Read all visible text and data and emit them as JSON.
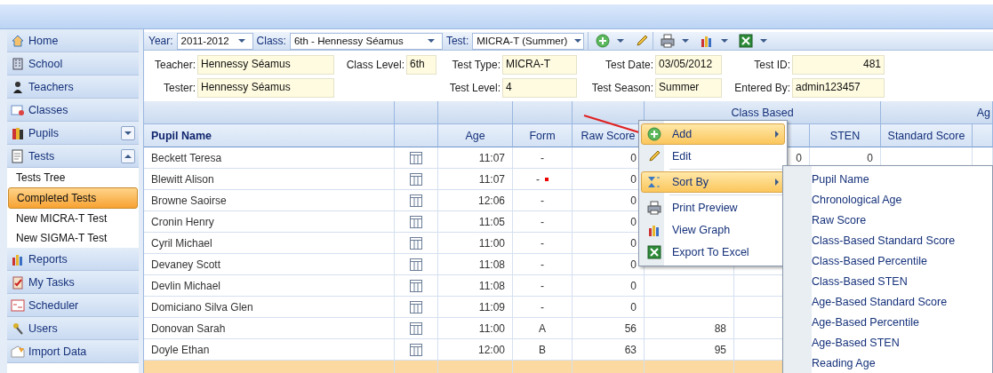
{
  "sidebar": {
    "items": [
      {
        "label": "Home"
      },
      {
        "label": "School"
      },
      {
        "label": "Teachers"
      },
      {
        "label": "Classes"
      },
      {
        "label": "Pupils",
        "expanded": false
      },
      {
        "label": "Tests",
        "expanded": true,
        "children": [
          {
            "label": "Tests Tree",
            "selected": false
          },
          {
            "label": "Completed Tests",
            "selected": true
          },
          {
            "label": "New MICRA-T Test",
            "selected": false
          },
          {
            "label": "New SIGMA-T Test",
            "selected": false
          }
        ]
      },
      {
        "label": "Reports"
      },
      {
        "label": "My Tasks"
      },
      {
        "label": "Scheduler"
      },
      {
        "label": "Users"
      },
      {
        "label": "Import Data"
      }
    ]
  },
  "toolbar": {
    "filters": [
      {
        "label": "Year:",
        "value": "2011-2012"
      },
      {
        "label": "Class:",
        "value": "6th - Hennessy Séamus"
      },
      {
        "label": "Test:",
        "value": "MICRA-T (Summer)"
      }
    ]
  },
  "details": {
    "teacher": {
      "label": "Teacher:",
      "value": "Hennessy Séamus"
    },
    "class_level": {
      "label": "Class Level:",
      "value": "6th"
    },
    "test_type": {
      "label": "Test Type:",
      "value": "MICRA-T"
    },
    "test_date": {
      "label": "Test Date:",
      "value": "03/05/2012"
    },
    "test_id": {
      "label": "Test ID:",
      "value": "481"
    },
    "tester": {
      "label": "Tester:",
      "value": "Hennessy Séamus"
    },
    "test_level": {
      "label": "Test Level:",
      "value": "4"
    },
    "test_season": {
      "label": "Test Season:",
      "value": "Summer"
    },
    "entered_by": {
      "label": "Entered By:",
      "value": "admin123457"
    }
  },
  "table": {
    "groups": [
      {
        "label": "Class Based"
      },
      {
        "label": "Ag"
      }
    ],
    "columns": [
      {
        "label": "Pupil Name"
      },
      {},
      {
        "label": "Age"
      },
      {
        "label": "Form"
      },
      {
        "label": "Raw Score"
      },
      {},
      {},
      {
        "label": "STEN"
      },
      {
        "label": "Standard Score"
      },
      {}
    ],
    "rows": [
      {
        "selected": false,
        "marked": false,
        "cells": [
          "Beckett Teresa",
          "",
          "11:07",
          "-",
          "0",
          "",
          "0",
          "0"
        ]
      },
      {
        "selected": false,
        "marked": true,
        "cells": [
          "Blewitt Alison",
          "",
          "11:07",
          "-",
          "0"
        ]
      },
      {
        "selected": false,
        "marked": false,
        "cells": [
          "Browne Saoirse",
          "",
          "12:06",
          "-",
          "0"
        ]
      },
      {
        "selected": false,
        "marked": false,
        "cells": [
          "Cronin Henry",
          "",
          "11:05",
          "-",
          "0"
        ]
      },
      {
        "selected": false,
        "marked": false,
        "cells": [
          "Cyril Michael",
          "",
          "11:00",
          "-",
          "0"
        ]
      },
      {
        "selected": false,
        "marked": false,
        "cells": [
          "Devaney Scott",
          "",
          "11:08",
          "-",
          "0"
        ]
      },
      {
        "selected": false,
        "marked": false,
        "cells": [
          "Devlin Michael",
          "",
          "11:08",
          "-",
          "0"
        ]
      },
      {
        "selected": false,
        "marked": false,
        "cells": [
          "Domiciano Silva Glen",
          "",
          "11:09",
          "-",
          "0"
        ]
      },
      {
        "selected": false,
        "marked": false,
        "cells": [
          "Donovan Sarah",
          "",
          "11:00",
          "A",
          "56",
          "88"
        ]
      },
      {
        "selected": false,
        "marked": false,
        "cells": [
          "Doyle Ethan",
          "",
          "12:00",
          "B",
          "63",
          "95"
        ]
      },
      {
        "selected": true,
        "marked": false,
        "cells": []
      }
    ]
  },
  "context_menu": {
    "items": [
      {
        "label": "Add",
        "highlighted": true,
        "submenu": true
      },
      {
        "label": "Edit",
        "highlighted": false,
        "submenu": false
      },
      {
        "label": "Sort By",
        "highlighted": true,
        "submenu": true
      },
      {
        "label": "Print Preview",
        "highlighted": false,
        "submenu": false
      },
      {
        "label": "View Graph",
        "highlighted": false,
        "submenu": false
      },
      {
        "label": "Export To Excel",
        "highlighted": false,
        "submenu": false
      }
    ],
    "submenu": [
      "Pupil Name",
      "Chronological Age",
      "Raw Score",
      "Class-Based Standard Score",
      "Class-Based Percentile",
      "Class-Based STEN",
      "Age-Based Standard Score",
      "Age-Based Percentile",
      "Age-Based STEN",
      "Reading Age"
    ]
  }
}
